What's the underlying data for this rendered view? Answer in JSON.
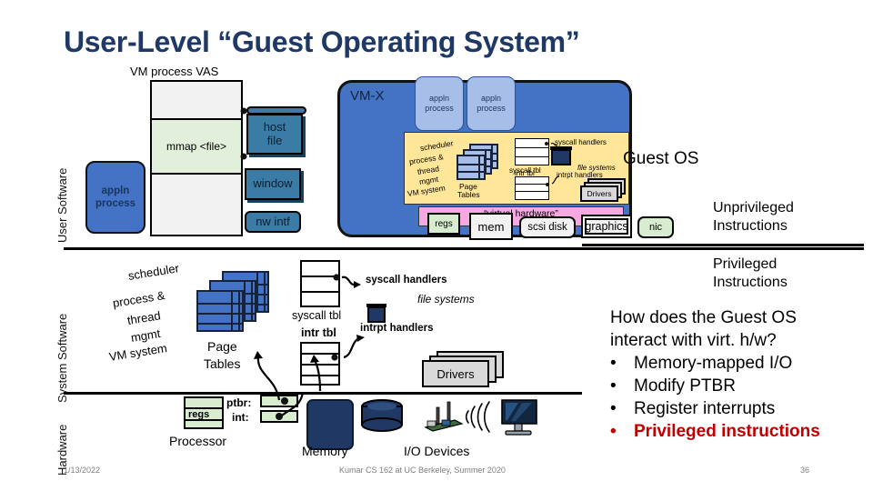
{
  "slide": {
    "title": "User-Level “Guest Operating System”",
    "bands": {
      "user": "User Software",
      "system": "System Software",
      "hardware": "Hardware"
    }
  },
  "vas": {
    "caption": "VM process VAS",
    "mmap_label": "mmap <file>",
    "appln_process": "appln\nprocess",
    "appln_line1": "appln",
    "appln_line2": "process",
    "resources": [
      {
        "id": "host-file",
        "label": "host\nfile",
        "line1": "host",
        "line2": "file"
      },
      {
        "id": "window",
        "label": "window"
      },
      {
        "id": "nw-intf",
        "label": "nw intf"
      }
    ]
  },
  "vmx": {
    "label": "VM-X",
    "guest_os_label": "Guest OS",
    "processes": [
      {
        "line1": "appln",
        "line2": "process"
      },
      {
        "line1": "appln",
        "line2": "process"
      }
    ],
    "guest": {
      "scheduler": "scheduler",
      "process_thread_mgmt_1": "process &",
      "process_thread_mgmt_2": "thread",
      "process_thread_mgmt_3": "mgmt",
      "vm_system": "VM system",
      "page_tables_1": "Page",
      "page_tables_2": "Tables",
      "syscall_tbl": "syscall tbl",
      "syscall_handlers": "syscall handlers",
      "file_systems": "file systems",
      "intr_tbl": "intr tbl",
      "intrpt_handlers": "intrpt handlers",
      "drivers": "Drivers"
    },
    "virtual_hardware_label": "“virtual hardware”",
    "virtual_devices": [
      {
        "id": "regs",
        "label": "regs"
      },
      {
        "id": "mem",
        "label": "mem"
      },
      {
        "id": "scsi-disk",
        "label": "scsi disk"
      },
      {
        "id": "graphics",
        "label": "graphics"
      },
      {
        "id": "nic",
        "label": "nic"
      }
    ]
  },
  "system_software": {
    "scheduler": "scheduler",
    "process_thread_1": "process &",
    "process_thread_2": "thread",
    "process_thread_3": "mgmt",
    "vm_system": "VM system",
    "page_tables_1": "Page",
    "page_tables_2": "Tables",
    "syscall_tbl": "syscall tbl",
    "syscall_handlers": "syscall handlers",
    "file_systems": "file systems",
    "intr_tbl": "intr tbl",
    "intrpt_handlers": "intrpt handlers",
    "drivers": "Drivers"
  },
  "hardware": {
    "regs": "regs",
    "ptbr": "ptbr:",
    "int": "int:",
    "processor": "Processor",
    "memory": "Memory",
    "io_devices": "I/O Devices"
  },
  "annotations": {
    "unprivileged_1": "Unprivileged",
    "unprivileged_2": "Instructions",
    "privileged_1": "Privileged",
    "privileged_2": "Instructions",
    "question_1": "How does the Guest OS",
    "question_2": "interact with virt. h/w?",
    "bullet_char": "•",
    "bullets": [
      "Memory-mapped I/O",
      "Modify PTBR",
      "Register interrupts",
      "Privileged instructions"
    ]
  },
  "footer": {
    "date": "1/13/2022",
    "center": "Kumar CS 162 at UC Berkeley, Summer 2020",
    "page": "36"
  },
  "colors": {
    "title": "#1F3864",
    "process_blue": "#4472C4",
    "resource_steel": "#3A7CA5",
    "guest_os_yellow": "#FFE699",
    "virtual_hw_pink": "#F6A9E0",
    "green_chip": "#D8ECCF",
    "highlight_red": "#C00000"
  }
}
